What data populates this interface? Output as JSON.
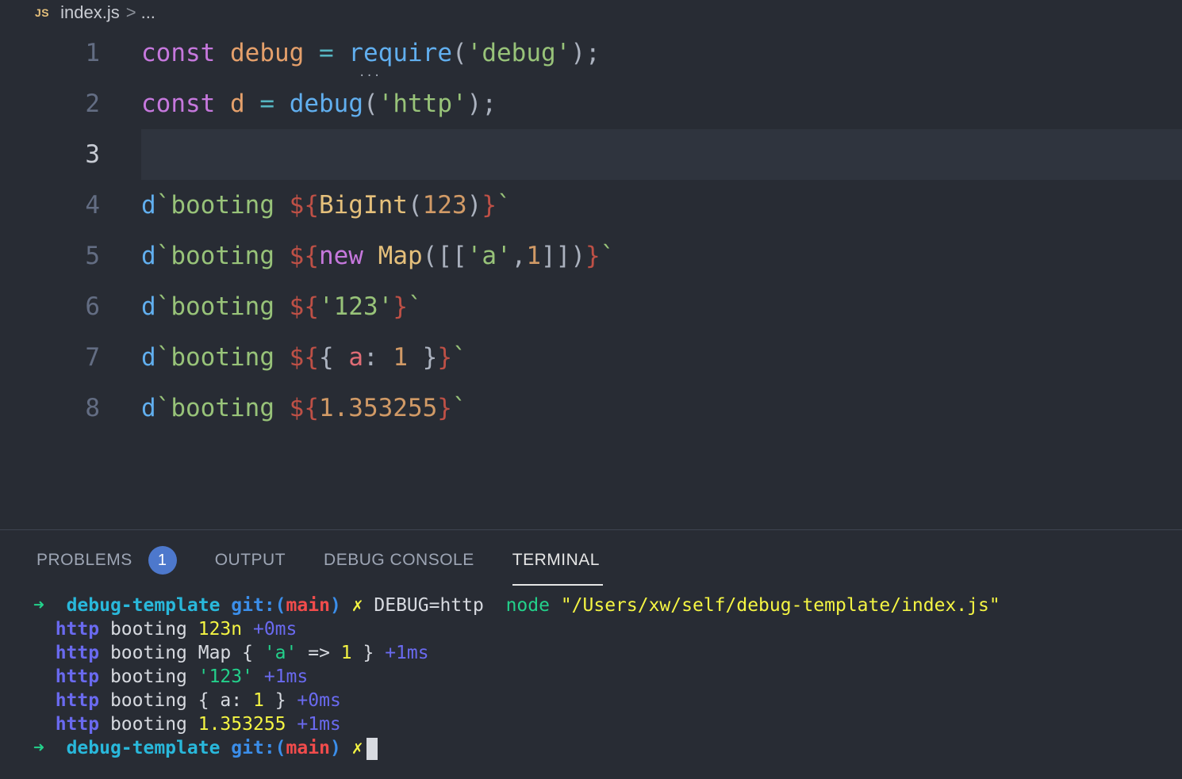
{
  "breadcrumb": {
    "lang_icon": "JS",
    "file": "index.js",
    "sep": ">",
    "more": "..."
  },
  "editor": {
    "current_line": 3,
    "lines": [
      {
        "n": "1",
        "tokens": [
          [
            "kw",
            "const"
          ],
          [
            "plain",
            " "
          ],
          [
            "var",
            "debug"
          ],
          [
            "plain",
            " "
          ],
          [
            "op",
            "="
          ],
          [
            "plain",
            " "
          ],
          [
            "fn",
            "require"
          ],
          [
            "pun",
            "("
          ],
          [
            "str",
            "'debug'"
          ],
          [
            "pun",
            ");"
          ]
        ]
      },
      {
        "n": "2",
        "tokens": [
          [
            "kw",
            "const"
          ],
          [
            "plain",
            " "
          ],
          [
            "var",
            "d"
          ],
          [
            "plain",
            " "
          ],
          [
            "op",
            "="
          ],
          [
            "plain",
            " "
          ],
          [
            "fn",
            "debug"
          ],
          [
            "pun",
            "("
          ],
          [
            "str",
            "'http'"
          ],
          [
            "pun",
            ");"
          ]
        ]
      },
      {
        "n": "3",
        "tokens": []
      },
      {
        "n": "4",
        "tokens": [
          [
            "fn",
            "d"
          ],
          [
            "str",
            "`booting "
          ],
          [
            "tpl",
            "${"
          ],
          [
            "cls",
            "BigInt"
          ],
          [
            "pun",
            "("
          ],
          [
            "num",
            "123"
          ],
          [
            "pun",
            ")"
          ],
          [
            "tpl",
            "}"
          ],
          [
            "str",
            "`"
          ]
        ]
      },
      {
        "n": "5",
        "tokens": [
          [
            "fn",
            "d"
          ],
          [
            "str",
            "`booting "
          ],
          [
            "tpl",
            "${"
          ],
          [
            "kw",
            "new"
          ],
          [
            "plain",
            " "
          ],
          [
            "cls",
            "Map"
          ],
          [
            "pun",
            "([["
          ],
          [
            "str",
            "'a'"
          ],
          [
            "pun",
            ","
          ],
          [
            "num",
            "1"
          ],
          [
            "pun",
            "]])"
          ],
          [
            "tpl",
            "}"
          ],
          [
            "str",
            "`"
          ]
        ]
      },
      {
        "n": "6",
        "tokens": [
          [
            "fn",
            "d"
          ],
          [
            "str",
            "`booting "
          ],
          [
            "tpl",
            "${"
          ],
          [
            "str",
            "'123'"
          ],
          [
            "tpl",
            "}"
          ],
          [
            "str",
            "`"
          ]
        ]
      },
      {
        "n": "7",
        "tokens": [
          [
            "fn",
            "d"
          ],
          [
            "str",
            "`booting "
          ],
          [
            "tpl",
            "${"
          ],
          [
            "pun",
            "{ "
          ],
          [
            "prop",
            "a"
          ],
          [
            "pun",
            ": "
          ],
          [
            "num",
            "1"
          ],
          [
            "pun",
            " }"
          ],
          [
            "tpl",
            "}"
          ],
          [
            "str",
            "`"
          ]
        ]
      },
      {
        "n": "8",
        "tokens": [
          [
            "fn",
            "d"
          ],
          [
            "str",
            "`booting "
          ],
          [
            "tpl",
            "${"
          ],
          [
            "num",
            "1.353255"
          ],
          [
            "tpl",
            "}"
          ],
          [
            "str",
            "`"
          ]
        ]
      }
    ]
  },
  "panel": {
    "tabs": [
      {
        "label": "PROBLEMS",
        "badge": "1",
        "active": false
      },
      {
        "label": "OUTPUT",
        "active": false
      },
      {
        "label": "DEBUG CONSOLE",
        "active": false
      },
      {
        "label": "TERMINAL",
        "active": true
      }
    ]
  },
  "terminal": {
    "prompt": {
      "arrow": "➜",
      "dir": "debug-template",
      "git": "git:(",
      "branch": "main",
      "git_close": ")",
      "dirty": "✗"
    },
    "command": {
      "env": "DEBUG=http",
      "node": "node",
      "path": "\"/Users/xw/self/debug-template/index.js\""
    },
    "output": [
      {
        "ns": "http",
        "text": "booting ",
        "parts": [
          [
            "t-yel",
            "123n"
          ]
        ],
        "delta": "+0ms"
      },
      {
        "ns": "http",
        "text": "booting ",
        "parts": [
          [
            "t-txt",
            "Map { "
          ],
          [
            "t-grn",
            "'a'"
          ],
          [
            "t-txt",
            " => "
          ],
          [
            "t-yel",
            "1"
          ],
          [
            "t-txt",
            " }"
          ]
        ],
        "delta": "+1ms"
      },
      {
        "ns": "http",
        "text": "booting ",
        "parts": [
          [
            "t-grn",
            "'123'"
          ]
        ],
        "delta": "+1ms"
      },
      {
        "ns": "http",
        "text": "booting ",
        "parts": [
          [
            "t-txt",
            "{ a: "
          ],
          [
            "t-yel",
            "1"
          ],
          [
            "t-txt",
            " }"
          ]
        ],
        "delta": "+0ms"
      },
      {
        "ns": "http",
        "text": "booting ",
        "parts": [
          [
            "t-yel",
            "1.353255"
          ]
        ],
        "delta": "+1ms"
      }
    ]
  }
}
